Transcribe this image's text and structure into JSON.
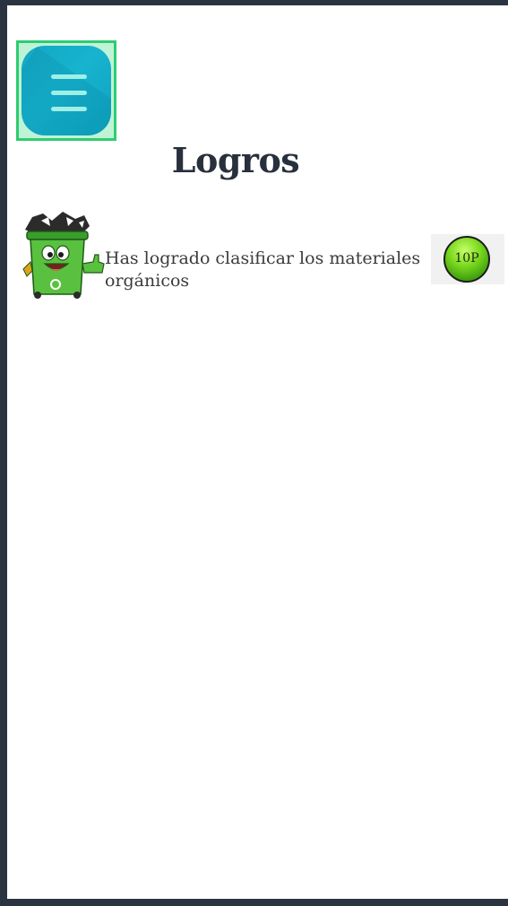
{
  "page": {
    "title": "Logros"
  },
  "menu": {
    "icon": "menu-icon"
  },
  "achievements": [
    {
      "icon": "recycle-bin-mascot-icon",
      "text": "Has logrado clasificar los materiales orgánicos",
      "badge": "10P",
      "badge_color": "#5cc41a"
    }
  ],
  "colors": {
    "menu_button": "#14a7c4",
    "menu_highlight": "#2ecc71",
    "title": "#27303c"
  }
}
